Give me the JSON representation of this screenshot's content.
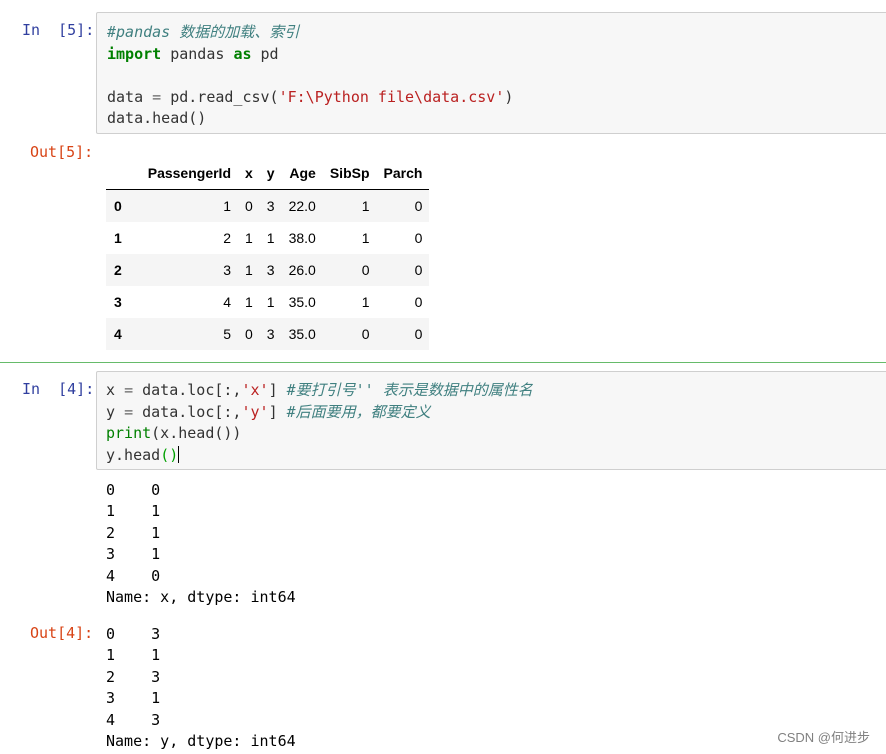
{
  "cell1": {
    "in_prompt": "In  [5]:",
    "out_prompt": "Out[5]:",
    "code": {
      "l1_comment": "#pandas 数据的加载、索引",
      "l2_kw_import": "import",
      "l2_mid": " pandas ",
      "l2_kw_as": "as",
      "l2_end": " pd",
      "l4_a": "data ",
      "l4_op": "=",
      "l4_b": " pd.read_csv(",
      "l4_str": "'F:\\Python file\\data.csv'",
      "l4_c": ")",
      "l5": "data.head()"
    },
    "table": {
      "columns": [
        "",
        "PassengerId",
        "x",
        "y",
        "Age",
        "SibSp",
        "Parch"
      ],
      "rows": [
        [
          "0",
          "1",
          "0",
          "3",
          "22.0",
          "1",
          "0"
        ],
        [
          "1",
          "2",
          "1",
          "1",
          "38.0",
          "1",
          "0"
        ],
        [
          "2",
          "3",
          "1",
          "3",
          "26.0",
          "0",
          "0"
        ],
        [
          "3",
          "4",
          "1",
          "1",
          "35.0",
          "1",
          "0"
        ],
        [
          "4",
          "5",
          "0",
          "3",
          "35.0",
          "0",
          "0"
        ]
      ]
    }
  },
  "cell2": {
    "in_prompt": "In  [4]:",
    "out_prompt": "Out[4]:",
    "code": {
      "l1_a": "x ",
      "l1_op": "=",
      "l1_b": " data.loc[:,",
      "l1_str": "'x'",
      "l1_c": "] ",
      "l1_comment": "#要打引号'' 表示是数据中的属性名",
      "l2_a": "y ",
      "l2_op": "=",
      "l2_b": " data.loc[:,",
      "l2_str": "'y'",
      "l2_c": "] ",
      "l2_comment": "#后面要用，都要定义",
      "l3_fn": "print",
      "l3_rest": "(x.head())",
      "l4_a": "y.head",
      "l4_paren": "()"
    },
    "stdout": "0    0\n1    1\n2    1\n3    1\n4    0\nName: x, dtype: int64",
    "result": "0    3\n1    1\n2    3\n3    1\n4    3\nName: y, dtype: int64"
  },
  "watermark": "CSDN @何进步",
  "colors": {
    "in_prompt": "#303f9f",
    "out_prompt": "#d84315",
    "comment": "#408080",
    "keyword": "#008000",
    "string": "#ba2121",
    "selected_cell_bar": "#66bb6a"
  }
}
